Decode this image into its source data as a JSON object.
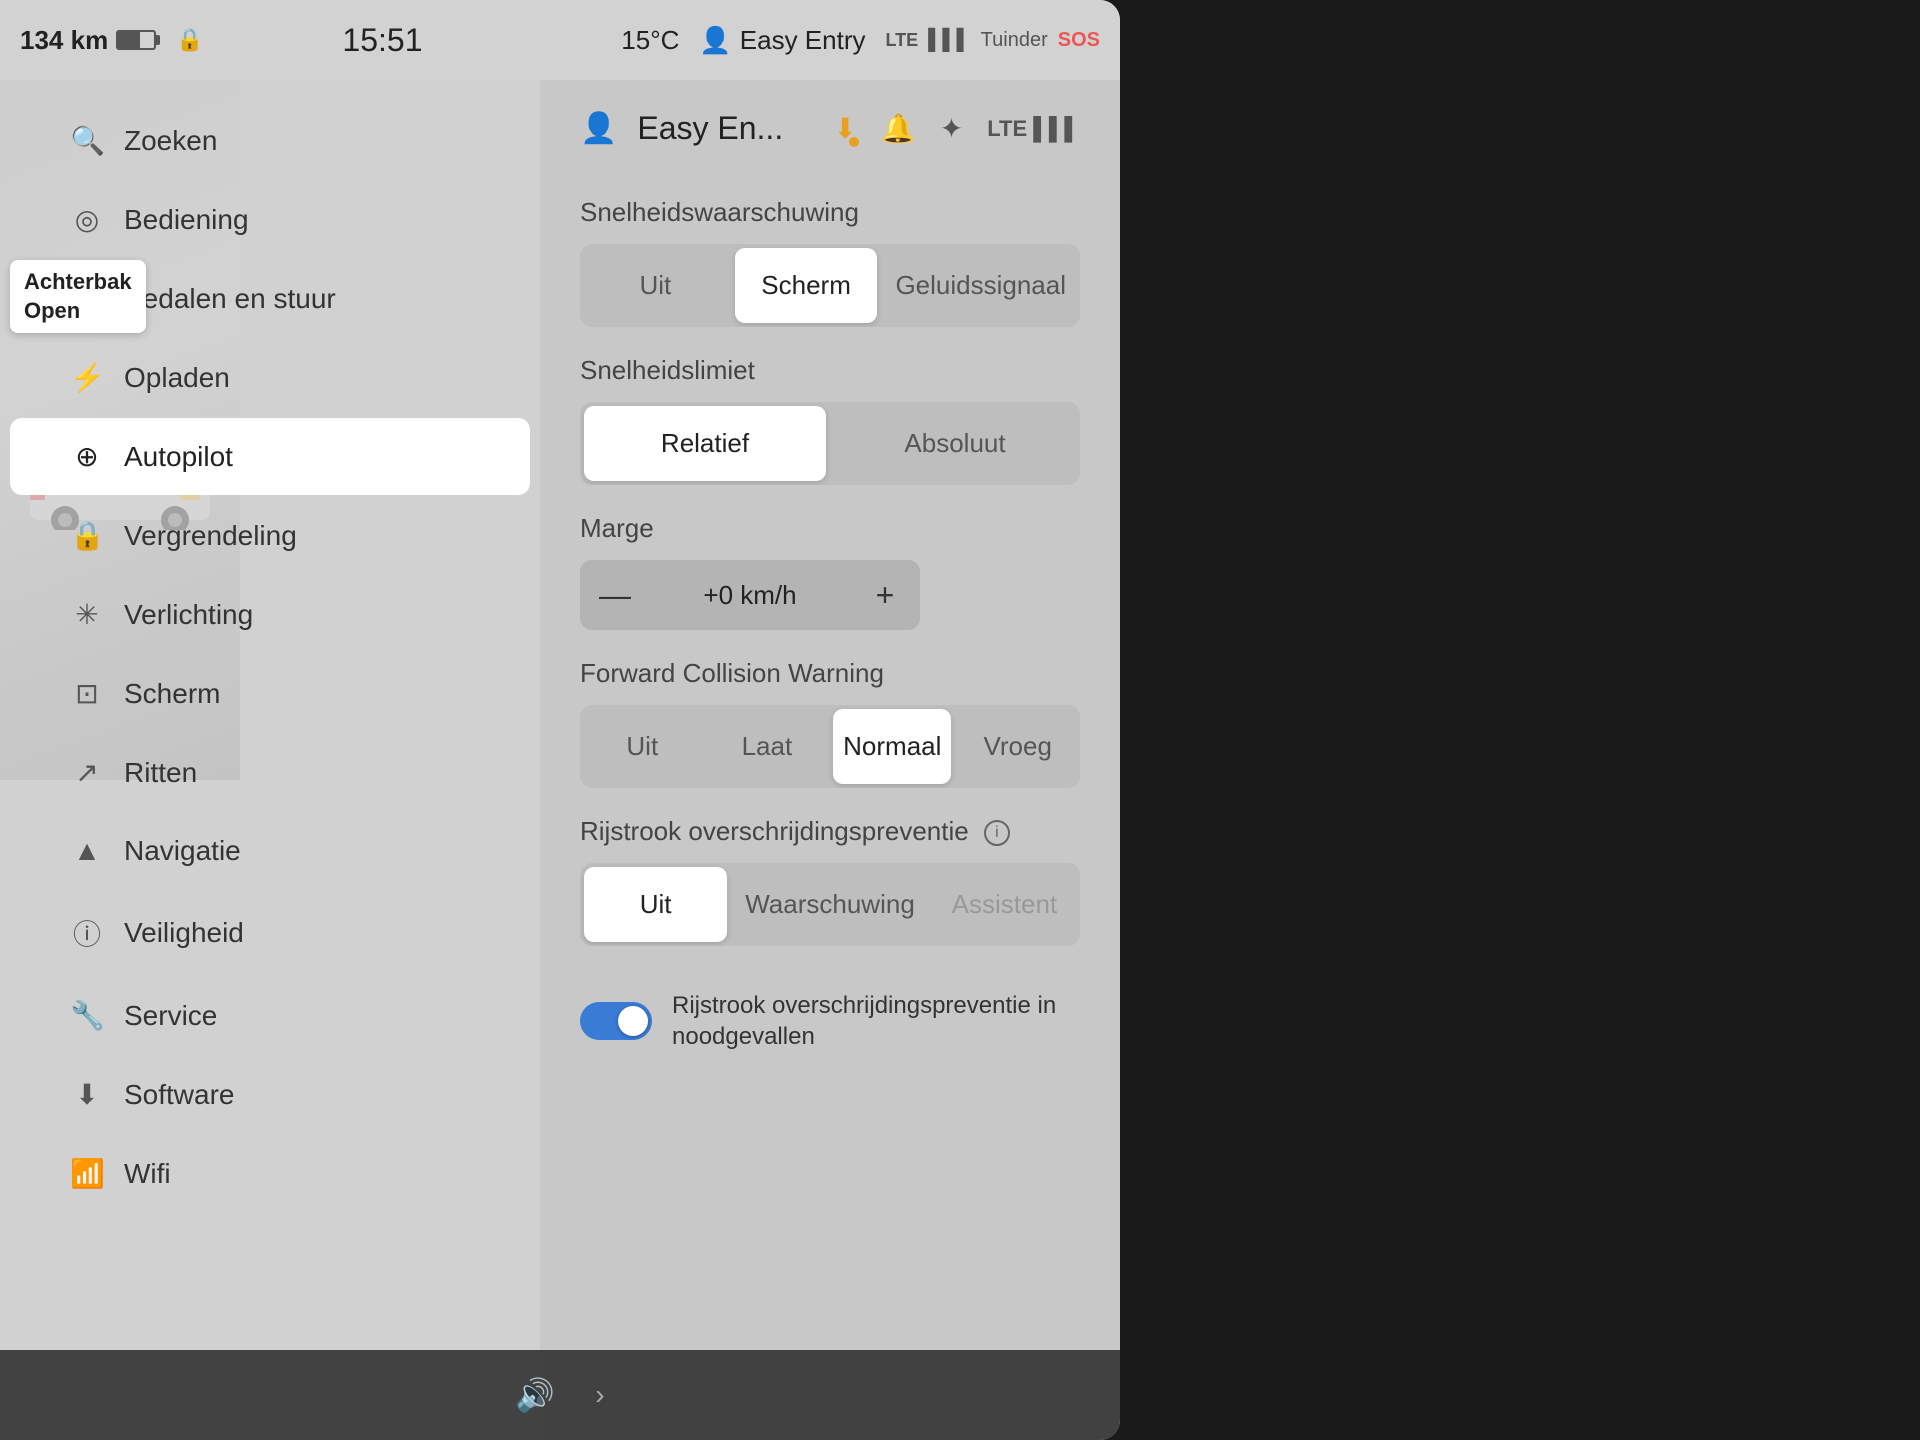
{
  "statusBar": {
    "range": "134 km",
    "lockIcon": "🔒",
    "time": "15:51",
    "temp": "15°C",
    "profileIcon": "👤",
    "profileLabel": "Easy Entry",
    "lteLabel": "LTE",
    "networkLabel": "Tuinder",
    "sosLabel": "SOS"
  },
  "achterbak": {
    "line1": "Achterbak",
    "line2": "Open"
  },
  "sidebar": {
    "items": [
      {
        "id": "zoeken",
        "icon": "🔍",
        "label": "Zoeken"
      },
      {
        "id": "bediening",
        "icon": "⊙",
        "label": "Bediening"
      },
      {
        "id": "pedalen",
        "icon": "🚗",
        "label": "Pedalen en stuur"
      },
      {
        "id": "opladen",
        "icon": "⚡",
        "label": "Opladen"
      },
      {
        "id": "autopilot",
        "icon": "⊕",
        "label": "Autopilot",
        "active": true
      },
      {
        "id": "vergrendeling",
        "icon": "🔒",
        "label": "Vergrendeling"
      },
      {
        "id": "verlichting",
        "icon": "✳",
        "label": "Verlichting"
      },
      {
        "id": "scherm",
        "icon": "⊡",
        "label": "Scherm"
      },
      {
        "id": "ritten",
        "icon": "↗",
        "label": "Ritten"
      },
      {
        "id": "navigatie",
        "icon": "▲",
        "label": "Navigatie"
      },
      {
        "id": "veiligheid",
        "icon": "ⓘ",
        "label": "Veiligheid"
      },
      {
        "id": "service",
        "icon": "🔧",
        "label": "Service"
      },
      {
        "id": "software",
        "icon": "⬇",
        "label": "Software"
      },
      {
        "id": "wifi",
        "icon": "📶",
        "label": "Wifi"
      }
    ]
  },
  "content": {
    "headerIcon": "👤",
    "headerTitle": "Easy En...",
    "downloadIcon": "⬇",
    "bellIcon": "🔔",
    "btIcon": "✦",
    "lteIcon": "LTE",
    "snelheidswaarschuwing": {
      "title": "Snelheidswaarschuwing",
      "options": [
        {
          "id": "uit",
          "label": "Uit",
          "active": false
        },
        {
          "id": "scherm",
          "label": "Scherm",
          "active": true
        },
        {
          "id": "geluidssignaal",
          "label": "Geluidssignaal",
          "active": false
        }
      ]
    },
    "snelheidslimiet": {
      "title": "Snelheidslimiet",
      "options": [
        {
          "id": "relatief",
          "label": "Relatief",
          "active": true
        },
        {
          "id": "absoluut",
          "label": "Absoluut",
          "active": false
        }
      ]
    },
    "marge": {
      "title": "Marge",
      "minusLabel": "—",
      "value": "+0 km/h",
      "plusLabel": "+"
    },
    "forwardCollision": {
      "title": "Forward Collision Warning",
      "options": [
        {
          "id": "uit",
          "label": "Uit",
          "active": false
        },
        {
          "id": "laat",
          "label": "Laat",
          "active": false
        },
        {
          "id": "normaal",
          "label": "Normaal",
          "active": true
        },
        {
          "id": "vroeg",
          "label": "Vroeg",
          "active": false
        }
      ]
    },
    "rijstrook": {
      "title": "Rijstrook overschrijdingspreventie",
      "hasInfo": true,
      "options": [
        {
          "id": "uit",
          "label": "Uit",
          "active": true
        },
        {
          "id": "waarschuwing",
          "label": "Waarschuwing",
          "active": false
        },
        {
          "id": "assistent",
          "label": "Assistent",
          "active": false,
          "disabled": true
        }
      ]
    },
    "rijstrookToggle": {
      "label": "Rijstrook overschrijdingspreventie in\nnoodgevallen",
      "enabled": true
    }
  },
  "taskbar": {
    "speakerIcon": "🔊",
    "chevronIcon": "›"
  }
}
